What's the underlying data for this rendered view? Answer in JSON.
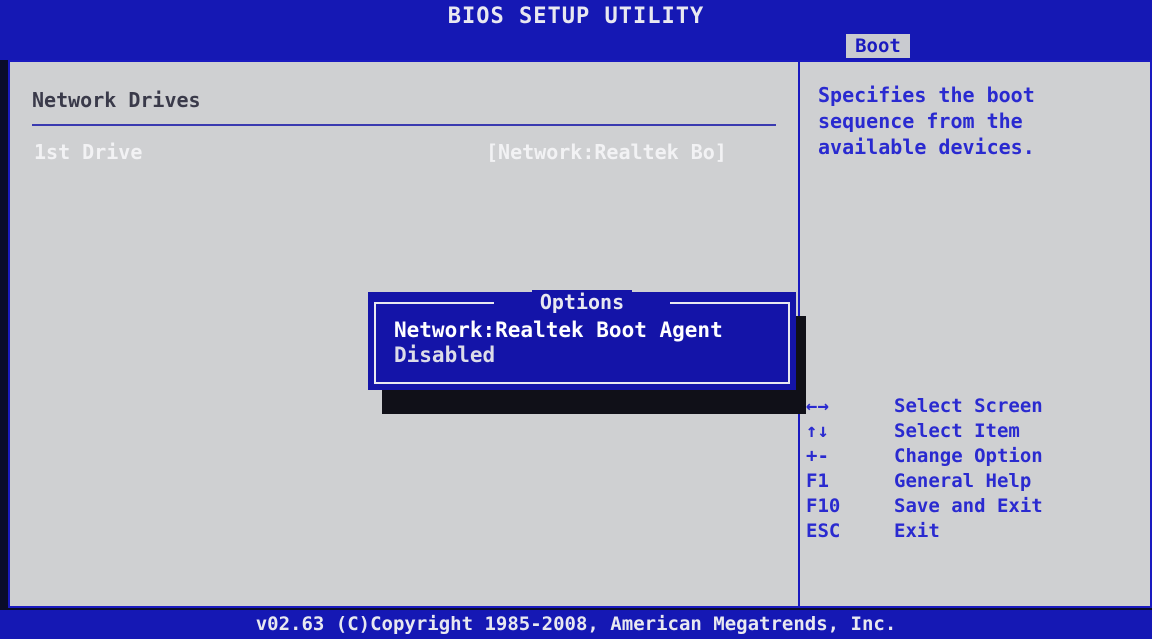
{
  "header": {
    "title": "BIOS SETUP UTILITY"
  },
  "tabs": [
    {
      "label": "Boot"
    }
  ],
  "main": {
    "section_title": "Network Drives",
    "settings": [
      {
        "label": "1st Drive",
        "value": "[Network:Realtek Bo]"
      }
    ]
  },
  "help": {
    "text": "Specifies the boot sequence from the available devices.",
    "keys": [
      {
        "key": "←→",
        "action": "Select Screen"
      },
      {
        "key": "↑↓",
        "action": "Select Item"
      },
      {
        "key": "+-",
        "action": "Change Option"
      },
      {
        "key": "F1",
        "action": "General Help"
      },
      {
        "key": "F10",
        "action": "Save and Exit"
      },
      {
        "key": "ESC",
        "action": "Exit"
      }
    ]
  },
  "popup": {
    "title": "Options",
    "options": [
      {
        "label": "Network:Realtek Boot Agent",
        "selected": true
      },
      {
        "label": "Disabled",
        "selected": false
      }
    ]
  },
  "footer": {
    "text": "v02.63 (C)Copyright 1985-2008, American Megatrends, Inc."
  },
  "colors": {
    "bar_blue": "#1518b4",
    "panel_gray": "#cfd0d2",
    "help_text_blue": "#2a2ad0",
    "popup_blue": "#1414a8"
  }
}
